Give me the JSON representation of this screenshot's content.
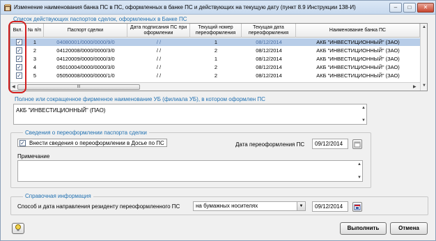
{
  "window": {
    "title": "Изменение наименования банка ПС в ПС, оформленных в банке ПС и действующих на текущую дату (пункт 8.9 Инструкции 138-И)",
    "controls": {
      "minimize": "–",
      "maximize": "□",
      "close": "✕"
    }
  },
  "deals": {
    "group_label": "Список действующих паспортов сделок, оформленных в Банке ПС",
    "columns": [
      "Вкл.",
      "№ п/п",
      "Паспорт сделки",
      "Дата подписания ПС при оформлении",
      "Текущий номер переоформления",
      "Текущая дата переоформления",
      "Наименование банка ПС"
    ],
    "rows": [
      {
        "checked": true,
        "num": "1",
        "ps": "04080001/0000/0000/9/0",
        "sign_date": "/ /",
        "reissue_no": "1",
        "reissue_date": "08/12/2014",
        "bank": "АКБ \"ИНВЕСТИЦИОННЫЙ\" (ЗАО)"
      },
      {
        "checked": true,
        "num": "2",
        "ps": "04120008/0000/0000/3/0",
        "sign_date": "/ /",
        "reissue_no": "2",
        "reissue_date": "08/12/2014",
        "bank": "АКБ \"ИНВЕСТИЦИОННЫЙ\" (ЗАО)"
      },
      {
        "checked": true,
        "num": "3",
        "ps": "04120009/0000/0000/3/0",
        "sign_date": "/ /",
        "reissue_no": "1",
        "reissue_date": "08/12/2014",
        "bank": "АКБ \"ИНВЕСТИЦИОННЫЙ\" (ЗАО)"
      },
      {
        "checked": true,
        "num": "4",
        "ps": "05010004/0000/0000/3/0",
        "sign_date": "/ /",
        "reissue_no": "2",
        "reissue_date": "08/12/2014",
        "bank": "АКБ \"ИНВЕСТИЦИОННЫЙ\" (ЗАО)"
      },
      {
        "checked": true,
        "num": "5",
        "ps": "05050008/0000/0000/1/0",
        "sign_date": "/ /",
        "reissue_no": "2",
        "reissue_date": "08/12/2014",
        "bank": "АКБ \"ИНВЕСТИЦИОННЫЙ\" (ЗАО)"
      }
    ],
    "selected_row": 0,
    "hscroll_thumb": "III"
  },
  "bank_name": {
    "label": "Полное или сокращенное фирменное наименование УБ (филиала УБ), в котором оформлен ПС",
    "value": "АКБ \"ИНВЕСТИЦИОННЫЙ\" (ПАО)"
  },
  "reissue": {
    "group_label": "Сведения о переоформлении паспорта сделки",
    "checkbox_label": "Внести сведения о переоформлении в Досье по ПС",
    "checkbox_checked": true,
    "date_label": "Дата переоформления ПС",
    "date_value": "09/12/2014",
    "note_label": "Примечание",
    "note_value": ""
  },
  "reference": {
    "group_label": "Справочная информация",
    "method_label": "Способ и дата направления резиденту переоформленного ПС",
    "method_value": "на бумажных носителях",
    "date_value": "09/12/2014"
  },
  "buttons": {
    "execute": "Выполнить",
    "cancel": "Отмена"
  },
  "colors": {
    "accent": "#1f6fb0",
    "selection": "#b8cde8",
    "highlight": "#d21f1f"
  }
}
